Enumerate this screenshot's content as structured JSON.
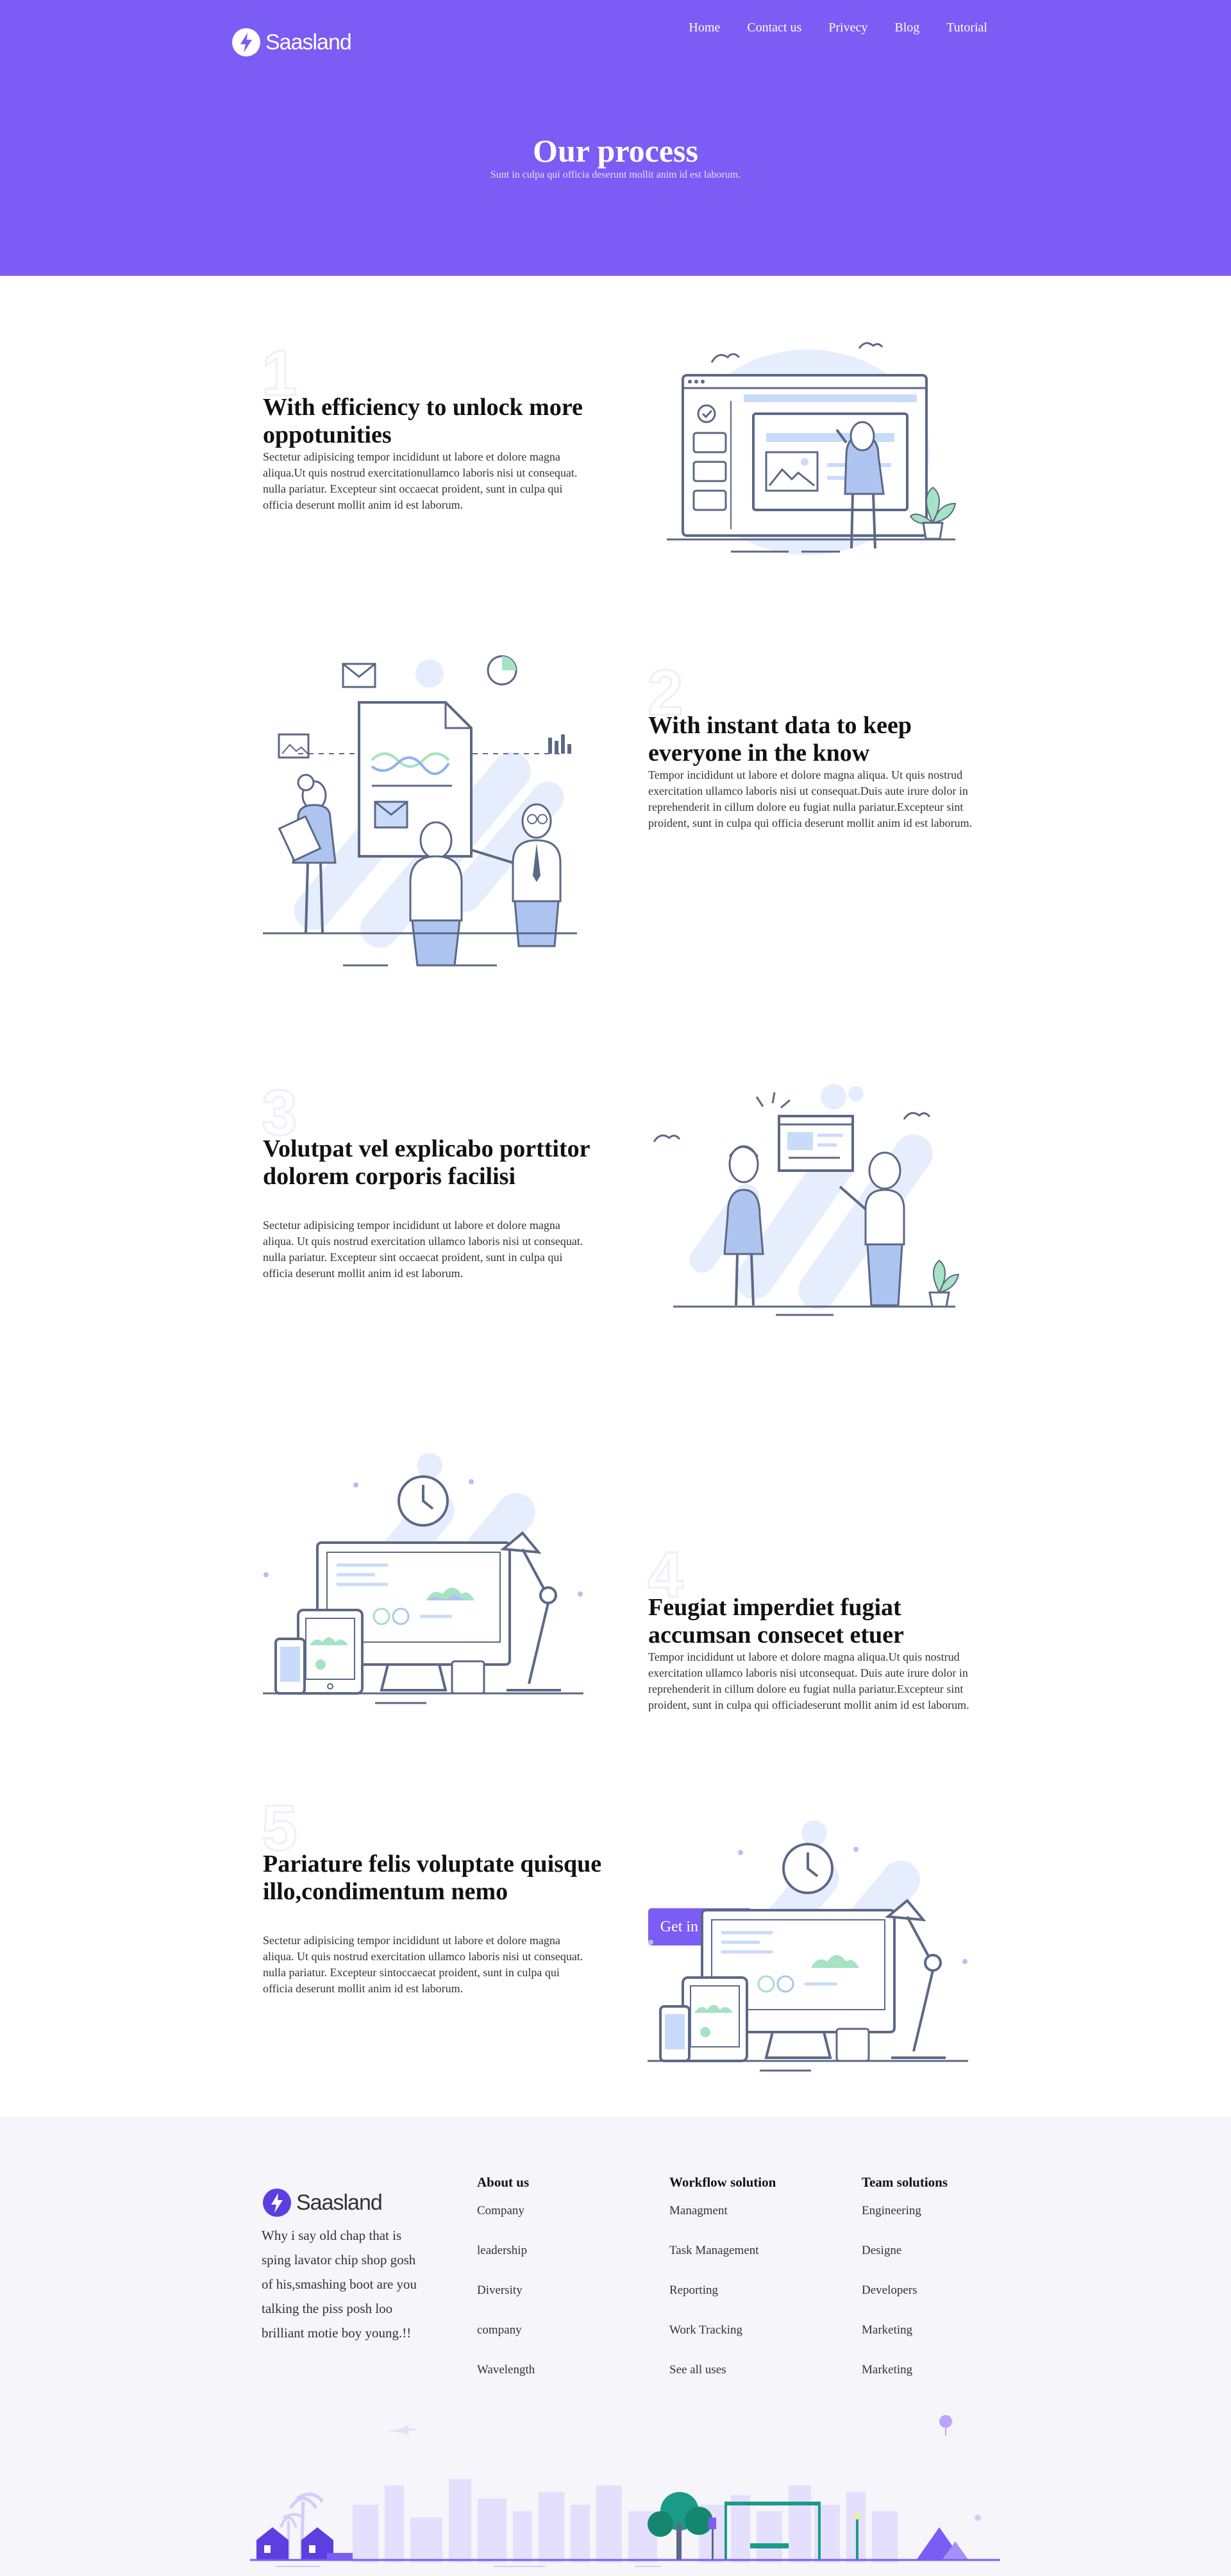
{
  "header": {
    "brand": "Saasland",
    "nav": [
      "Home",
      "Contact us",
      "Privecy",
      "Blog",
      "Tutorial"
    ],
    "title": "Our process",
    "subtitle": "Sunt in culpa qui officia deserunt mollit anim id est laborum."
  },
  "steps": [
    {
      "number": "1",
      "title": "With efficiency to unlock more oppotunities",
      "text": "Sectetur adipisicing tempor incididunt ut labore et dolore magna aliqua.Ut quis nostrud exercitationullamco laboris nisi ut consequat. nulla pariatur. Excepteur sint occaecat proident, sunt in culpa qui officia deserunt mollit anim id est laborum."
    },
    {
      "number": "2",
      "title": "With instant data to keep everyone in the know",
      "text": "Tempor incididunt ut labore et dolore magna aliqua. Ut quis nostrud exercitation ullamco laboris nisi ut consequat.Duis aute irure dolor in reprehenderit in cillum dolore eu fugiat nulla pariatur.Excepteur sint proident, sunt in culpa qui officia deserunt mollit anim id est laborum."
    },
    {
      "number": "3",
      "title": "Volutpat vel explicabo porttitor dolorem corporis facilisi",
      "text": "Sectetur adipisicing tempor incididunt ut labore et dolore magna aliqua. Ut quis nostrud exercitation ullamco laboris nisi ut consequat. nulla pariatur. Excepteur sint occaecat proident, sunt in culpa qui officia deserunt mollit anim id est laborum."
    },
    {
      "number": "4",
      "title": "Feugiat imperdiet fugiat accumsan consecet etuer",
      "text": "Tempor incididunt ut labore et dolore magna aliqua.Ut quis nostrud exercitation ullamco laboris nisi utconsequat. Duis aute irure dolor in reprehenderit in cillum dolore eu fugiat nulla pariatur.Excepteur sint proident, sunt in culpa qui officiadeserunt mollit anim id est laborum.",
      "button": "Get in Touch"
    },
    {
      "number": "5",
      "title": "Pariature felis voluptate quisque illo,condimentum nemo",
      "text": "Sectetur adipisicing tempor incididunt ut labore et dolore magna aliqua. Ut quis nostrud exercitation ullamco laboris nisi ut consequat. nulla pariatur. Excepteur sintoccaecat proident, sunt in culpa qui officia deserunt mollit anim id est laborum."
    }
  ],
  "footer": {
    "brand": "Saasland",
    "about": "Why i say old chap that is sping lavator chip shop gosh of his,smashing boot are you talking the piss posh loo brilliant motie boy young.!!",
    "columns": [
      {
        "title": "About us",
        "links": [
          "Company",
          "leadership",
          "Diversity",
          "company",
          "Wavelength"
        ]
      },
      {
        "title": "Workflow solution",
        "links": [
          "Managment",
          "Task Management",
          "Reporting",
          "Work Tracking",
          "See all uses"
        ]
      },
      {
        "title": "Team solutions",
        "links": [
          "Engineering",
          "Designe",
          "Developers",
          "Marketing",
          "Marketing"
        ]
      }
    ]
  },
  "colors": {
    "brand": "#7b5cf5",
    "footer_bg": "#f5f5fa",
    "illustration_blue": "#c9dbfb",
    "illustration_line": "#5c6887"
  },
  "icons": [
    "bolt-logo-icon"
  ]
}
